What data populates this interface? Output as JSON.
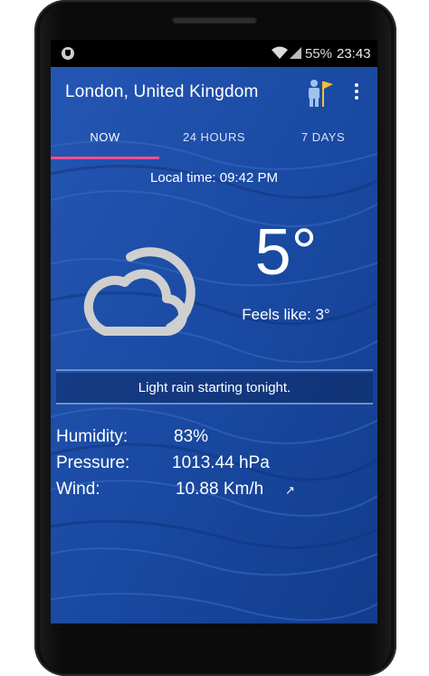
{
  "status_bar": {
    "battery_percent": "55%",
    "time": "23:43",
    "icons": [
      "shield-icon",
      "wifi-icon",
      "signal-icon"
    ]
  },
  "app_bar": {
    "location": "London, United Kingdom",
    "icons": [
      "person-flag-icon",
      "overflow-menu-icon"
    ]
  },
  "tabs": [
    {
      "label": "NOW",
      "active": true
    },
    {
      "label": "24 HOURS",
      "active": false
    },
    {
      "label": "7 DAYS",
      "active": false
    }
  ],
  "current": {
    "local_time": "Local time:  09:42 PM",
    "temperature": "5°",
    "feels_like": "Feels like: 3°",
    "condition_icon": "partly-cloudy-night-icon",
    "summary": "Light rain starting tonight."
  },
  "details": {
    "humidity_label": "Humidity:",
    "humidity_value": "83%",
    "pressure_label": "Pressure:",
    "pressure_value": "1013.44 hPa",
    "wind_label": "Wind:",
    "wind_value": "10.88 Km/h",
    "wind_direction_icon": "north-east-arrow-icon"
  },
  "colors": {
    "background_blue": "#17459a",
    "tab_indicator": "#ef4f91",
    "icon_gray": "#cfcfcf"
  }
}
